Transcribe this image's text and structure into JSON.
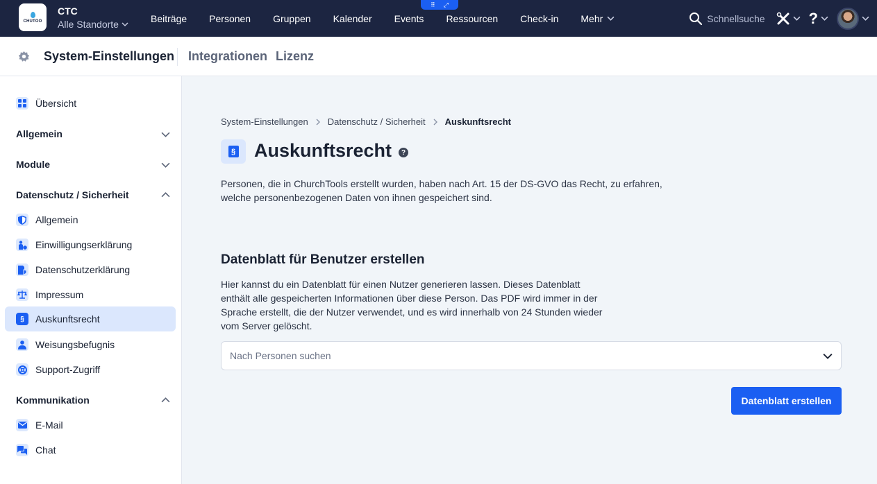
{
  "topbar": {
    "logo_text": "CHUTOO",
    "org_name": "CTC",
    "location_selector": "Alle Standorte",
    "nav_items": [
      "Beiträge",
      "Personen",
      "Gruppen",
      "Kalender",
      "Events",
      "Ressourcen",
      "Check-in",
      "Mehr"
    ],
    "search_label": "Schnellsuche"
  },
  "subheader": {
    "title": "System-Einstellungen",
    "tabs": [
      "Integrationen",
      "Lizenz"
    ]
  },
  "sidebar": {
    "overview": "Übersicht",
    "groups": {
      "allgemein": "Allgemein",
      "module": "Module",
      "datenschutz": "Datenschutz / Sicherheit",
      "kommunikation": "Kommunikation"
    },
    "datenschutz_items": [
      "Allgemein",
      "Einwilligungserklärung",
      "Datenschutzerklärung",
      "Impressum",
      "Auskunftsrecht",
      "Weisungsbefugnis",
      "Support-Zugriff"
    ],
    "kommunikation_items": [
      "E-Mail",
      "Chat"
    ],
    "active_item": "Auskunftsrecht"
  },
  "main": {
    "breadcrumb": [
      "System-Einstellungen",
      "Datenschutz / Sicherheit",
      "Auskunftsrecht"
    ],
    "page_icon_glyph": "§",
    "title": "Auskunftsrecht",
    "help_glyph": "?",
    "intro": "Personen, die in ChurchTools erstellt wurden, haben nach Art. 15 der DS-GVO das Recht, zu erfahren, welche personenbezogenen Daten von ihnen gespeichert sind.",
    "section_title": "Datenblatt für Benutzer erstellen",
    "section_description": "Hier kannst du ein Datenblatt für einen Nutzer generieren lassen. Dieses Datenblatt enthält alle gespeicherten Informationen über diese Person. Das PDF wird immer in der Sprache erstellt, die der Nutzer verwendet, und es wird innerhalb von 24 Stunden wieder vom Server gelöscht.",
    "person_search_placeholder": "Nach Personen suchen",
    "create_button": "Datenblatt erstellen"
  },
  "colors": {
    "topbar_bg": "#1c2541",
    "accent": "#1b5ff2",
    "active_item_bg": "#dbe7fd"
  }
}
